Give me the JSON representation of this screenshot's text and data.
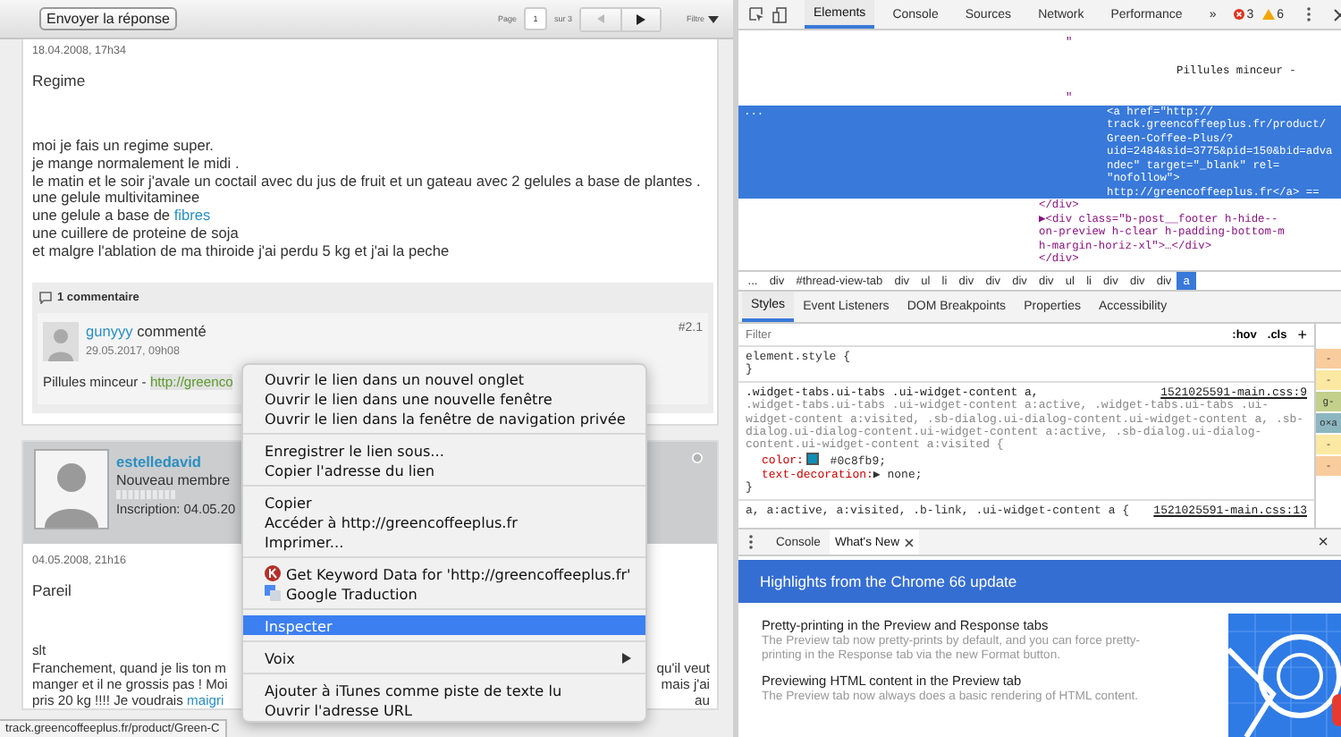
{
  "forum": {
    "toolbar": {
      "reply_button": "Envoyer la réponse",
      "page_label": "Page",
      "page_value": "1",
      "page_total": "sur 3",
      "filter": "Filtre"
    },
    "post": {
      "date": "18.04.2008, 17h34",
      "title": "Regime",
      "lines": [
        {
          "text": "moi je fais un regime super."
        },
        {
          "text": "je mange normalement le midi ."
        },
        {
          "text": "le matin et le soir j'avale un coctail avec du jus de fruit et un gateau avec 2 gelules a base de plantes ."
        },
        {
          "text": "une gelule multivitaminee"
        },
        {
          "text": "une gelule a base de ",
          "link": "fibres"
        },
        {
          "text": "une cuillere de proteine de soja"
        },
        {
          "text": "et malgre l'ablation de ma thiroide j'ai perdu 5 kg et j'ai la peche"
        }
      ],
      "comments": {
        "count": "1 commentaire",
        "items": [
          {
            "author": "gunyyy",
            "action": "commenté",
            "number": "#2.1",
            "date": "29.05.2017, 09h08",
            "text": "Pillules minceur - ",
            "link": "http://greenco"
          }
        ]
      }
    },
    "post2": {
      "author": "estelledavid",
      "role": "Nouveau membre",
      "signup": "Inscription: 04.05.20",
      "date": "04.05.2008, 21h16",
      "title": "Pareil",
      "lines": [
        {
          "text": "slt"
        },
        {
          "text": "Franchement, quand je lis ton m",
          "tail": "qu'il veut"
        },
        {
          "text": "manger et il ne grossis pas ! Moi",
          "tail": "mais j'ai"
        },
        {
          "text": "pris 20 kg !!!! Je voudrais ",
          "link": "maigri",
          "tail": "au"
        }
      ]
    },
    "status": "track.greencoffeeplus.fr/product/Green-C"
  },
  "context_menu": {
    "groups": [
      {
        "items": [
          {
            "kind": "text",
            "label": "Ouvrir le lien dans un nouvel onglet",
            "selected": false
          },
          {
            "kind": "text",
            "label": "Ouvrir le lien dans une nouvelle fenêtre",
            "selected": false
          },
          {
            "kind": "text",
            "label": "Ouvrir le lien dans la fenêtre de navigation privée",
            "selected": false
          }
        ]
      },
      {
        "items": [
          {
            "kind": "text",
            "label": "Enregistrer le lien sous...",
            "selected": false
          },
          {
            "kind": "text",
            "label": "Copier l'adresse du lien",
            "selected": false
          }
        ]
      },
      {
        "items": [
          {
            "kind": "text",
            "label": "Copier",
            "selected": false
          },
          {
            "kind": "text",
            "label": "Accéder à http://greencoffeeplus.fr",
            "selected": false
          },
          {
            "kind": "text",
            "label": "Imprimer...",
            "selected": false
          }
        ]
      },
      {
        "items": [
          {
            "kind": "keyword",
            "label": "Get Keyword Data for 'http://greencoffeeplus.fr'",
            "selected": false
          },
          {
            "kind": "translate",
            "label": "Google Traduction",
            "selected": false
          }
        ]
      },
      {
        "items": [
          {
            "kind": "text",
            "label": "Inspecter",
            "selected": true
          }
        ]
      },
      {
        "items": [
          {
            "kind": "submenu",
            "label": "Voix",
            "selected": false
          }
        ]
      },
      {
        "items": [
          {
            "kind": "text",
            "label": "Ajouter à iTunes comme piste de texte lu",
            "selected": false
          },
          {
            "kind": "text",
            "label": "Ouvrir l'adresse URL",
            "selected": false
          }
        ]
      }
    ]
  },
  "devtools": {
    "tabs": [
      {
        "label": "Elements",
        "selected": true
      },
      {
        "label": "Console",
        "selected": false
      },
      {
        "label": "Sources",
        "selected": false
      },
      {
        "label": "Network",
        "selected": false
      },
      {
        "label": "Performance",
        "selected": false
      }
    ],
    "more": "»",
    "errors": "3",
    "warnings": "6",
    "dom": [
      {
        "kind": "inner",
        "selected": false,
        "lines": [
          "\""
        ]
      },
      {
        "kind": "textnode",
        "selected": false,
        "lines": [
          "Pillules minceur -"
        ]
      },
      {
        "kind": "inner",
        "selected": false,
        "lines": [
          "\""
        ]
      },
      {
        "kind": "inner",
        "selected": true,
        "gutter": "...",
        "lines": [
          "<a href=\"http://",
          "track.greencoffeeplus.fr/product/",
          "Green-Coffee-Plus/?",
          "uid=2484&sid=3775&pid=150&bid=adva",
          "ndec\" target=\"_blank\" rel=",
          "\"nofollow\">",
          "http://greencoffeeplus.fr</a> =="
        ]
      },
      {
        "kind": "outer",
        "selected": false,
        "lines": [
          "</div>"
        ]
      },
      {
        "kind": "outer",
        "selected": false,
        "lines": [
          "▶<div class=\"b-post__footer h-hide--",
          "on-preview h-clear h-padding-bottom-m",
          "h-margin-horiz-xl\">…</div>"
        ]
      },
      {
        "kind": "outer",
        "selected": false,
        "lines": [
          "</div>"
        ]
      }
    ],
    "breadcrumbs": [
      {
        "label": "...",
        "selected": false
      },
      {
        "label": "div",
        "selected": false
      },
      {
        "label": "#thread-view-tab",
        "selected": false
      },
      {
        "label": "div",
        "selected": false
      },
      {
        "label": "ul",
        "selected": false
      },
      {
        "label": "li",
        "selected": false
      },
      {
        "label": "div",
        "selected": false
      },
      {
        "label": "div",
        "selected": false
      },
      {
        "label": "div",
        "selected": false
      },
      {
        "label": "div",
        "selected": false
      },
      {
        "label": "ul",
        "selected": false
      },
      {
        "label": "li",
        "selected": false
      },
      {
        "label": "div",
        "selected": false
      },
      {
        "label": "div",
        "selected": false
      },
      {
        "label": "div",
        "selected": false
      },
      {
        "label": "a",
        "selected": true
      }
    ],
    "side_tabs": [
      {
        "label": "Styles",
        "selected": true
      },
      {
        "label": "Event Listeners",
        "selected": false
      },
      {
        "label": "DOM Breakpoints",
        "selected": false
      },
      {
        "label": "Properties",
        "selected": false
      },
      {
        "label": "Accessibility",
        "selected": false
      }
    ],
    "filter": {
      "placeholder": "Filter",
      "hov": ":hov",
      "cls": ".cls",
      "add": "+"
    },
    "element_style": {
      "open": "element.style {",
      "close": "}"
    },
    "rule": {
      "source": "1521025591-main.css:9",
      "matched": ".widget-tabs.ui-tabs .ui-widget-content a,",
      "rest": ".widget-tabs.ui-tabs .ui-widget-content a:active, .widget-tabs.ui-tabs .ui-widget-content a:visited, .sb-dialog.ui-dialog-content.ui-widget-content a, .sb-dialog.ui-dialog-content.ui-widget-content a:active, .sb-dialog.ui-dialog-content.ui-widget-content a:visited {",
      "props": [
        {
          "name": "color:",
          "value": "#0c8fb9;",
          "color": "#0c8fb9"
        },
        {
          "name": "text-decoration:",
          "value": "none;",
          "expander": "▶"
        }
      ],
      "close": "}"
    },
    "rule2": {
      "selector": "a, a:active, a:visited, .b-link, .ui-widget-content a {",
      "source": "1521025591-main.css:13"
    },
    "box_cells": [
      {
        "label": "-",
        "color": "#f9cc9d"
      },
      {
        "label": "-",
        "color": "#fbe8a3"
      },
      {
        "label": "g-",
        "color": "#c3d08b"
      },
      {
        "label": "o×a",
        "color": "#8cb6c0"
      },
      {
        "label": "-",
        "color": "#fbe8a3"
      },
      {
        "label": "-",
        "color": "#f9cc9d"
      }
    ],
    "drawer": {
      "tabs": [
        {
          "label": "Console",
          "selected": false,
          "closable": false
        },
        {
          "label": "What's New",
          "selected": true,
          "closable": true
        }
      ],
      "close": "×",
      "banner": "Highlights from the Chrome 66 update",
      "items": [
        {
          "title": "Pretty-printing in the Preview and Response tabs",
          "text": "The Preview tab now pretty-prints by default, and you can force pretty-printing in the Response tab via the new Format button."
        },
        {
          "title": "Previewing HTML content in the Preview tab",
          "text": "The Preview tab now always does a basic rendering of HTML content."
        }
      ]
    }
  }
}
